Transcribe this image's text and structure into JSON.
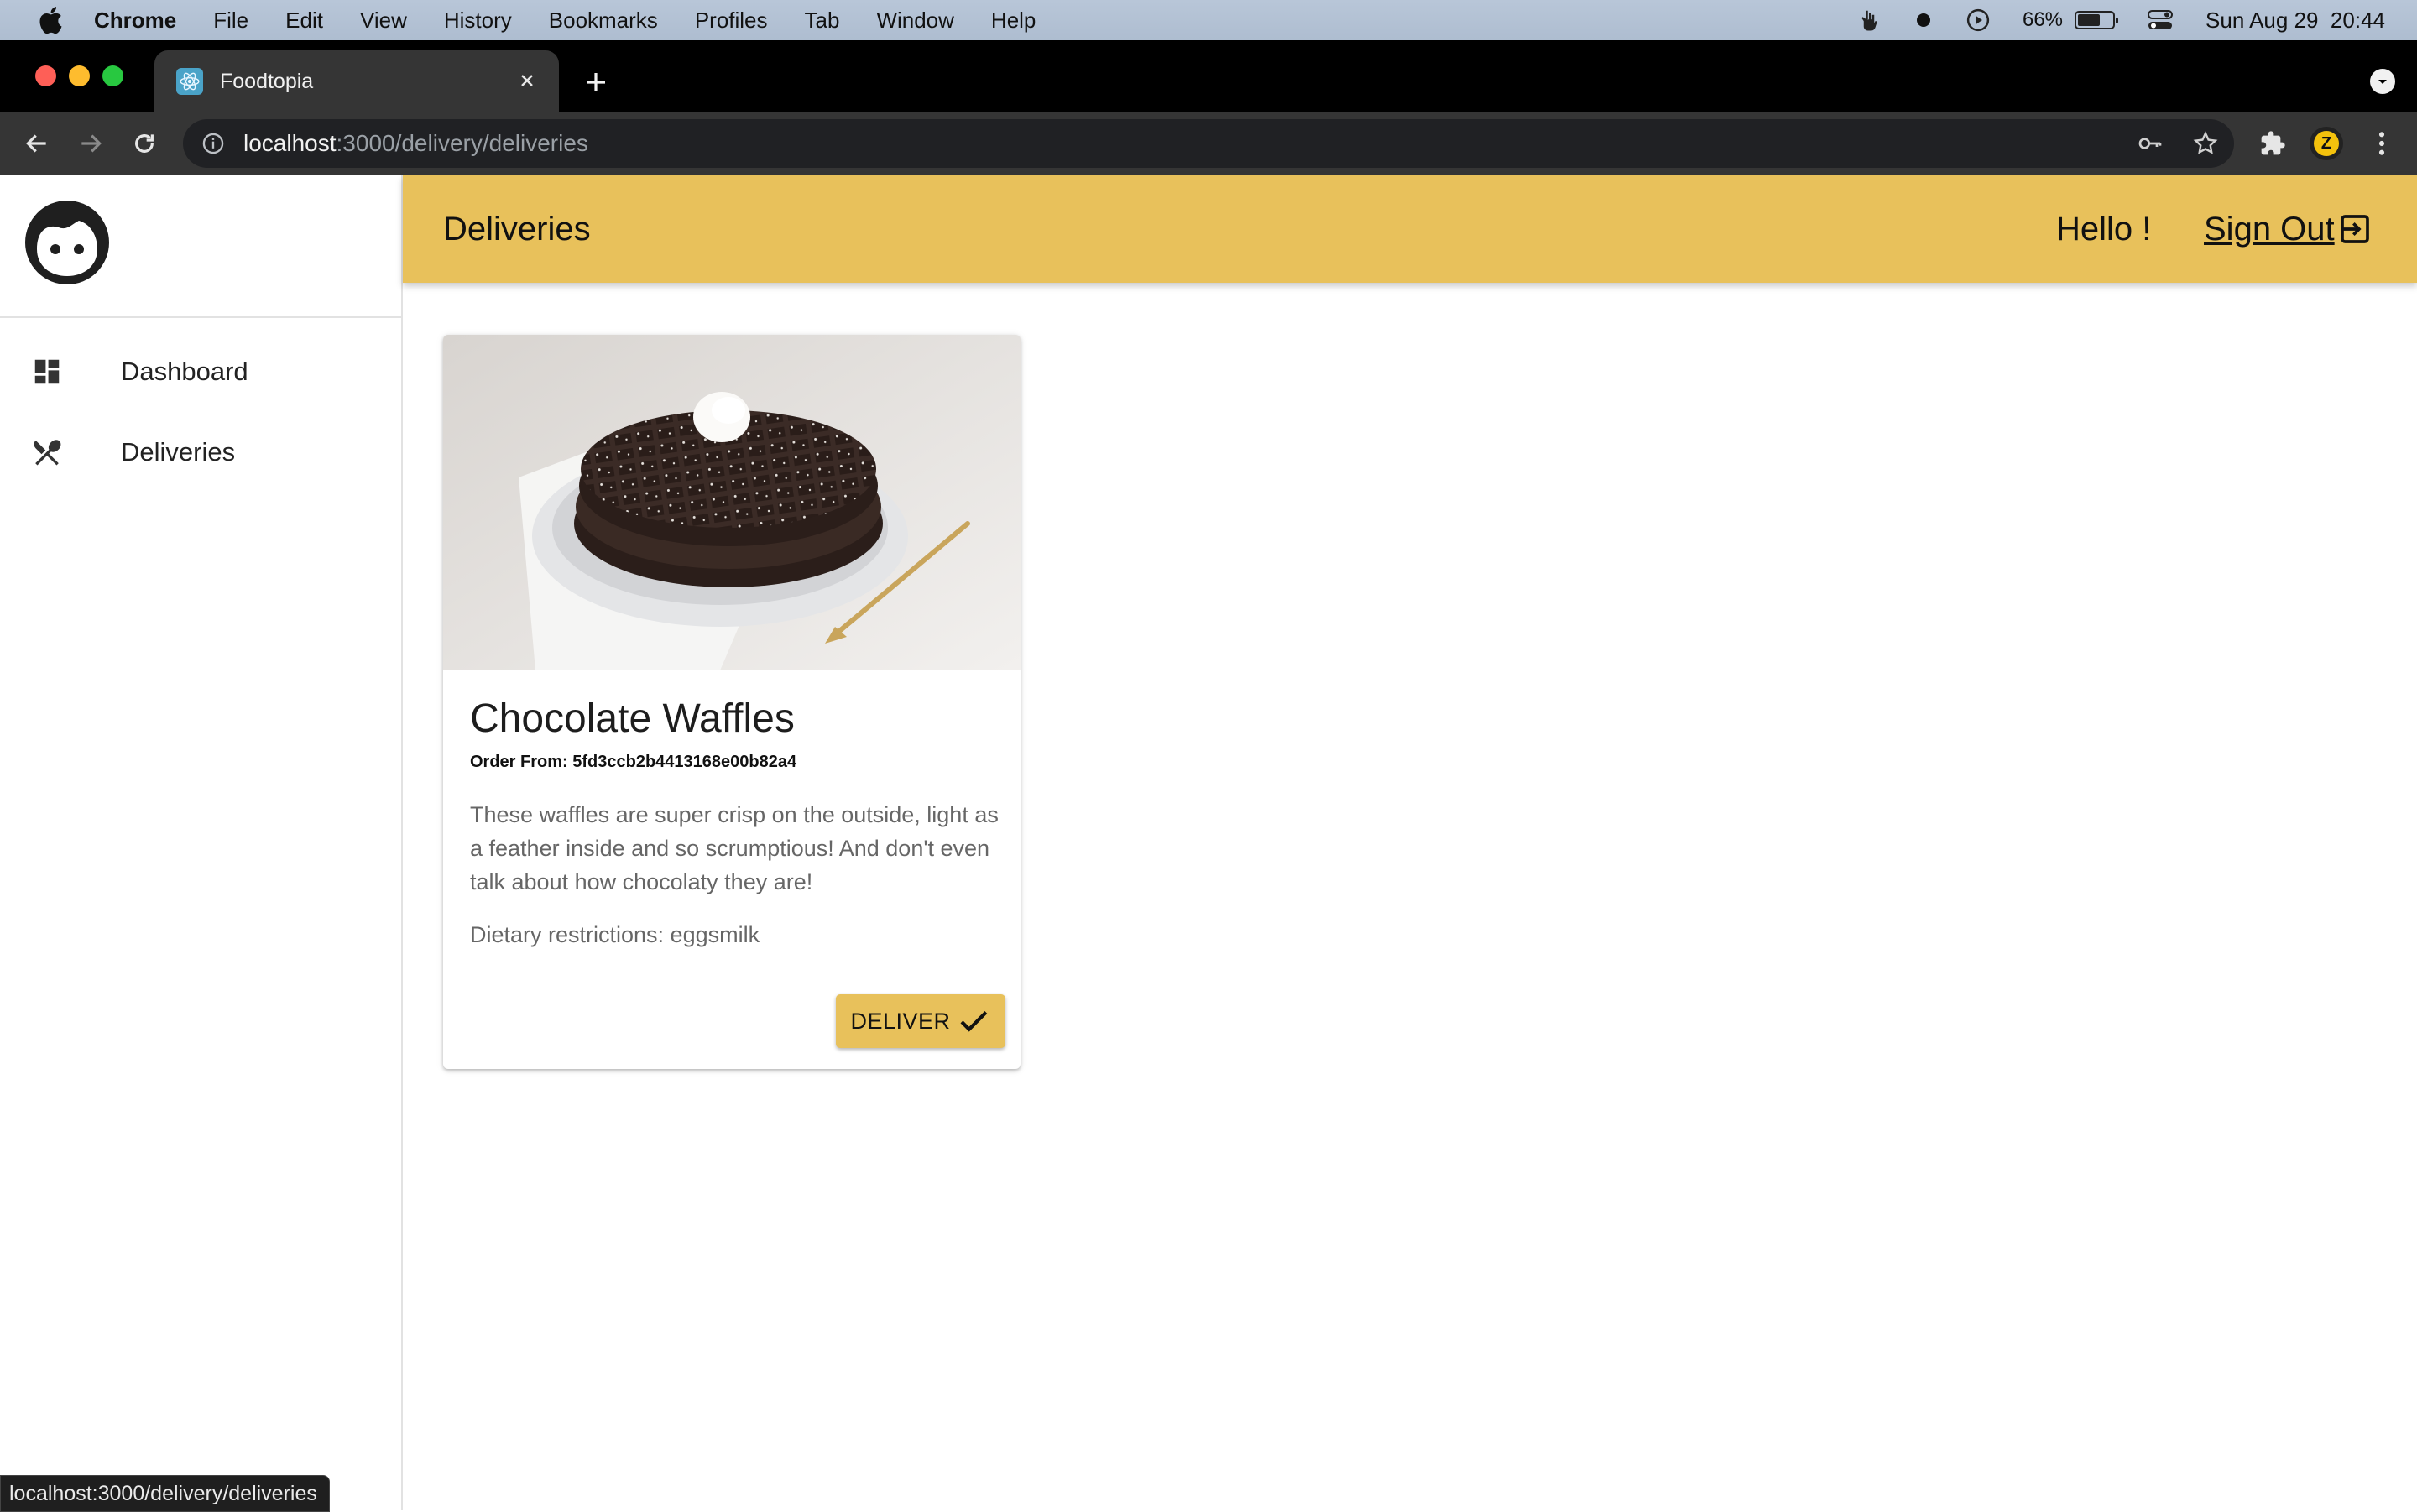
{
  "menubar": {
    "app_name": "Chrome",
    "items": [
      "File",
      "Edit",
      "View",
      "History",
      "Bookmarks",
      "Profiles",
      "Tab",
      "Window",
      "Help"
    ],
    "battery_percent": "66%",
    "battery_level": 0.66,
    "datetime": "Sun Aug 29  20:44"
  },
  "browser": {
    "tab_title": "Foodtopia",
    "url_host": "localhost",
    "url_path": ":3000/delivery/deliveries",
    "profile_initial": "Z"
  },
  "sidebar": {
    "items": [
      {
        "label": "Dashboard",
        "icon": "dashboard-icon"
      },
      {
        "label": "Deliveries",
        "icon": "fork-knife-icon"
      }
    ]
  },
  "header": {
    "title": "Deliveries",
    "greeting": "Hello !",
    "sign_out": "Sign Out"
  },
  "card": {
    "title": "Chocolate Waffles",
    "order_from": "Order From: 5fd3ccb2b4413168e00b82a4",
    "description": "These waffles are super crisp on the outside, light as a feather inside and so scrumptious! And don't even talk about how chocolaty they are!",
    "dietary": "Dietary restrictions: eggsmilk",
    "button_label": "DELIVER"
  },
  "status_url": "localhost:3000/delivery/deliveries",
  "colors": {
    "accent": "#e8c15b",
    "chrome_dark": "#353535"
  }
}
